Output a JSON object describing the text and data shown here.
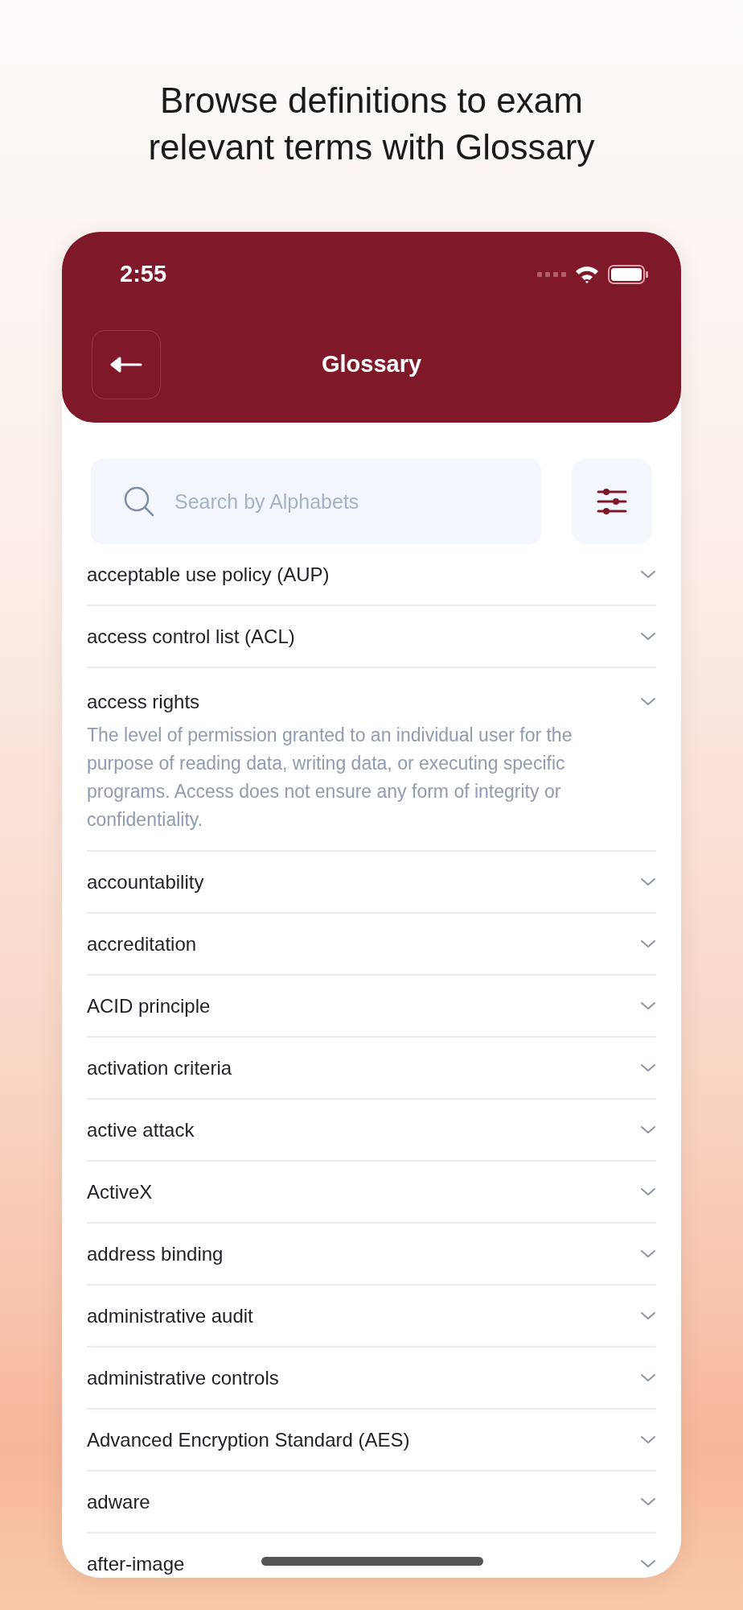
{
  "headline": "Browse definitions to exam relevant terms with Glossary",
  "status_bar": {
    "time": "2:55"
  },
  "header": {
    "title": "Glossary"
  },
  "search": {
    "placeholder": "Search by Alphabets"
  },
  "terms": [
    {
      "title": "acceptable use policy (AUP)",
      "expanded": false
    },
    {
      "title": "access control list (ACL)",
      "expanded": false
    },
    {
      "title": "access rights",
      "expanded": true,
      "definition": "The level of permission granted to an individual user for the purpose of reading data, writing data, or executing specific programs. Access does not ensure any form of integrity or confidentiality."
    },
    {
      "title": "accountability",
      "expanded": false
    },
    {
      "title": "accreditation",
      "expanded": false
    },
    {
      "title": "ACID principle",
      "expanded": false
    },
    {
      "title": "activation criteria",
      "expanded": false
    },
    {
      "title": "active attack",
      "expanded": false
    },
    {
      "title": "ActiveX",
      "expanded": false
    },
    {
      "title": "address binding",
      "expanded": false
    },
    {
      "title": "administrative audit",
      "expanded": false
    },
    {
      "title": "administrative controls",
      "expanded": false
    },
    {
      "title": "Advanced Encryption Standard (AES)",
      "expanded": false
    },
    {
      "title": "adware",
      "expanded": false
    },
    {
      "title": "after-image",
      "expanded": false
    }
  ]
}
